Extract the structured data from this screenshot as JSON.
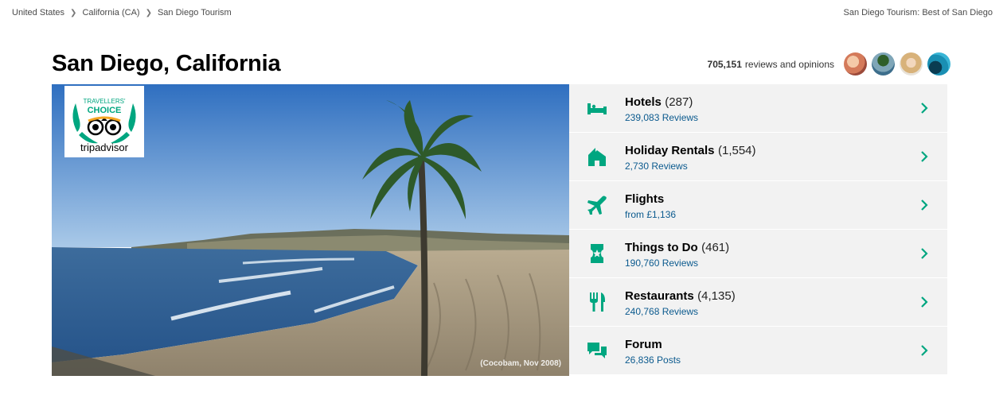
{
  "breadcrumb": {
    "items": [
      "United States",
      "California (CA)",
      "San Diego Tourism"
    ]
  },
  "header": {
    "top_right_link": "San Diego Tourism: Best of San Diego",
    "title": "San Diego, California",
    "reviews_count": "705,151",
    "reviews_label": "reviews and opinions"
  },
  "hero": {
    "badge_line1": "TRAVELLERS'",
    "badge_line2": "CHOICE",
    "badge_brand": "tripadvisor",
    "photo_credit": "(Cocobam, Nov 2008)"
  },
  "categories": [
    {
      "title": "Hotels",
      "count": "(287)",
      "sub": "239,083 Reviews",
      "icon": "bed-icon"
    },
    {
      "title": "Holiday Rentals",
      "count": "(1,554)",
      "sub": "2,730 Reviews",
      "icon": "house-icon"
    },
    {
      "title": "Flights",
      "count": "",
      "sub": "from £1,136",
      "icon": "plane-icon"
    },
    {
      "title": "Things to Do",
      "count": "(461)",
      "sub": "190,760 Reviews",
      "icon": "ticket-icon"
    },
    {
      "title": "Restaurants",
      "count": "(4,135)",
      "sub": "240,768 Reviews",
      "icon": "fork-knife-icon"
    },
    {
      "title": "Forum",
      "count": "",
      "sub": "26,836 Posts",
      "icon": "chat-bubbles-icon"
    }
  ],
  "colors": {
    "accent_green": "#00a680",
    "link_blue": "#0b5a8e",
    "row_background": "#f2f2f2"
  }
}
